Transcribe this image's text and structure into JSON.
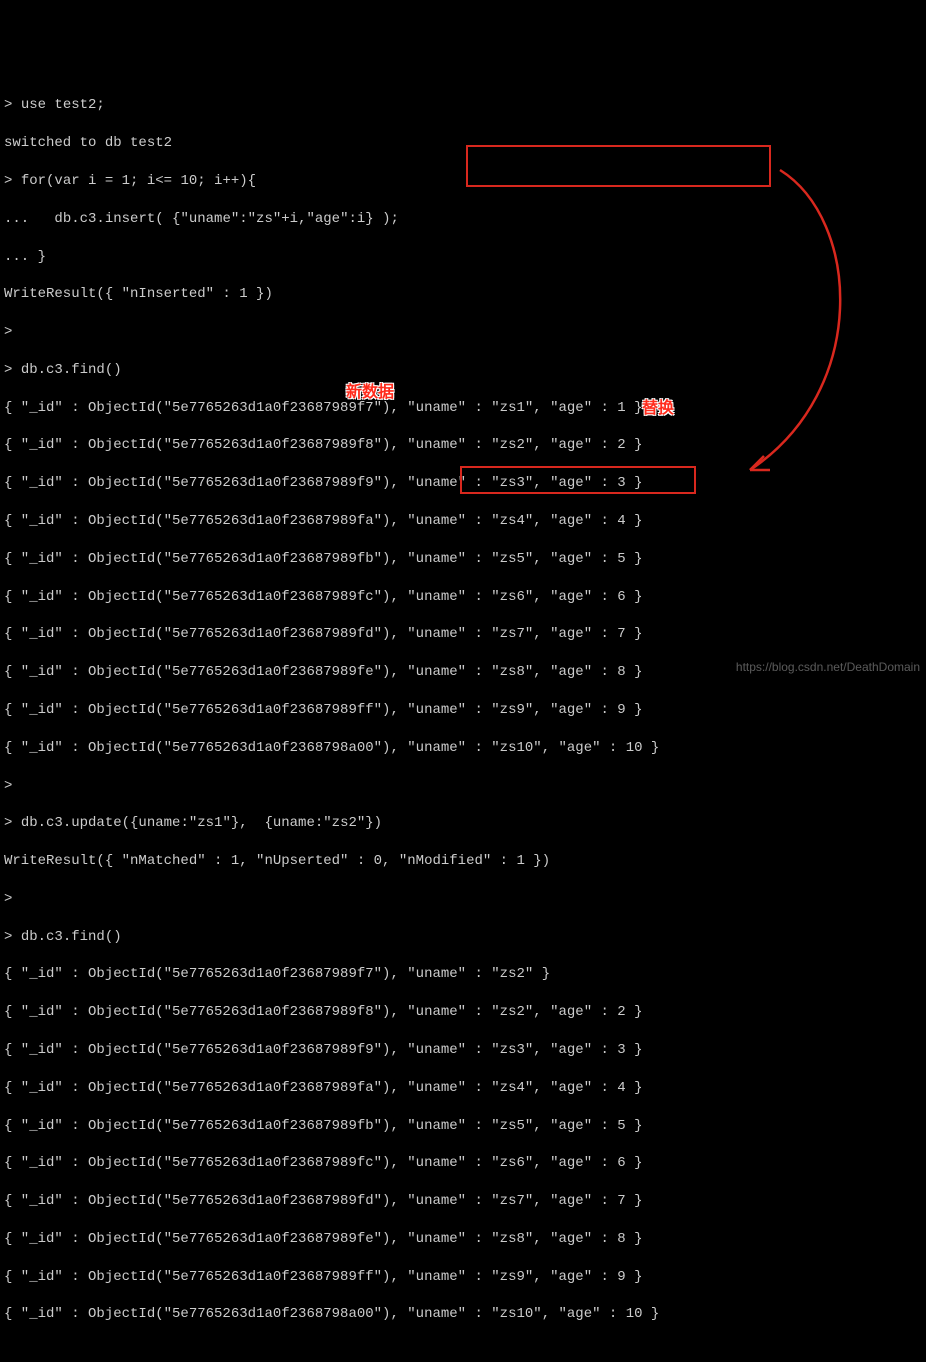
{
  "prompts": {
    "p": ">",
    "cont": "..."
  },
  "cmd": {
    "use": "use test2;",
    "use_resp": "switched to db test2",
    "for": "for(var i = 1; i<= 10; i++){",
    "insert": "  db.c3.insert( {\"uname\":\"zs\"+i,\"age\":i} );",
    "brace": "}",
    "wr_insert": "WriteResult({ \"nInserted\" : 1 })",
    "find": "db.c3.find()",
    "update": "db.c3.update({uname:\"zs1\"},  {uname:\"zs2\"})",
    "wr_update": "WriteResult({ \"nMatched\" : 1, \"nUpserted\" : 0, \"nModified\" : 1 })"
  },
  "find1": [
    "{ \"_id\" : ObjectId(\"5e7765263d1a0f23687989f7\"), \"uname\" : \"zs1\", \"age\" : 1 }",
    "{ \"_id\" : ObjectId(\"5e7765263d1a0f23687989f8\"), \"uname\" : \"zs2\", \"age\" : 2 }",
    "{ \"_id\" : ObjectId(\"5e7765263d1a0f23687989f9\"), \"uname\" : \"zs3\", \"age\" : 3 }",
    "{ \"_id\" : ObjectId(\"5e7765263d1a0f23687989fa\"), \"uname\" : \"zs4\", \"age\" : 4 }",
    "{ \"_id\" : ObjectId(\"5e7765263d1a0f23687989fb\"), \"uname\" : \"zs5\", \"age\" : 5 }",
    "{ \"_id\" : ObjectId(\"5e7765263d1a0f23687989fc\"), \"uname\" : \"zs6\", \"age\" : 6 }",
    "{ \"_id\" : ObjectId(\"5e7765263d1a0f23687989fd\"), \"uname\" : \"zs7\", \"age\" : 7 }",
    "{ \"_id\" : ObjectId(\"5e7765263d1a0f23687989fe\"), \"uname\" : \"zs8\", \"age\" : 8 }",
    "{ \"_id\" : ObjectId(\"5e7765263d1a0f23687989ff\"), \"uname\" : \"zs9\", \"age\" : 9 }",
    "{ \"_id\" : ObjectId(\"5e7765263d1a0f2368798a00\"), \"uname\" : \"zs10\", \"age\" : 10 }"
  ],
  "find2": [
    "{ \"_id\" : ObjectId(\"5e7765263d1a0f23687989f7\"), \"uname\" : \"zs2\" }",
    "{ \"_id\" : ObjectId(\"5e7765263d1a0f23687989f8\"), \"uname\" : \"zs2\", \"age\" : 2 }",
    "{ \"_id\" : ObjectId(\"5e7765263d1a0f23687989f9\"), \"uname\" : \"zs3\", \"age\" : 3 }",
    "{ \"_id\" : ObjectId(\"5e7765263d1a0f23687989fa\"), \"uname\" : \"zs4\", \"age\" : 4 }",
    "{ \"_id\" : ObjectId(\"5e7765263d1a0f23687989fb\"), \"uname\" : \"zs5\", \"age\" : 5 }",
    "{ \"_id\" : ObjectId(\"5e7765263d1a0f23687989fc\"), \"uname\" : \"zs6\", \"age\" : 6 }",
    "{ \"_id\" : ObjectId(\"5e7765263d1a0f23687989fd\"), \"uname\" : \"zs7\", \"age\" : 7 }",
    "{ \"_id\" : ObjectId(\"5e7765263d1a0f23687989fe\"), \"uname\" : \"zs8\", \"age\" : 8 }",
    "{ \"_id\" : ObjectId(\"5e7765263d1a0f23687989ff\"), \"uname\" : \"zs9\", \"age\" : 9 }",
    "{ \"_id\" : ObjectId(\"5e7765263d1a0f2368798a00\"), \"uname\" : \"zs10\", \"age\" : 10 }"
  ],
  "annotations": {
    "new_data": "新数据",
    "replace": "替换"
  },
  "watermark": "https://blog.csdn.net/DeathDomain",
  "colors": {
    "bg": "#000000",
    "fg": "#cccccc",
    "box": "#d9281e",
    "anno": "#ff2b1c"
  }
}
